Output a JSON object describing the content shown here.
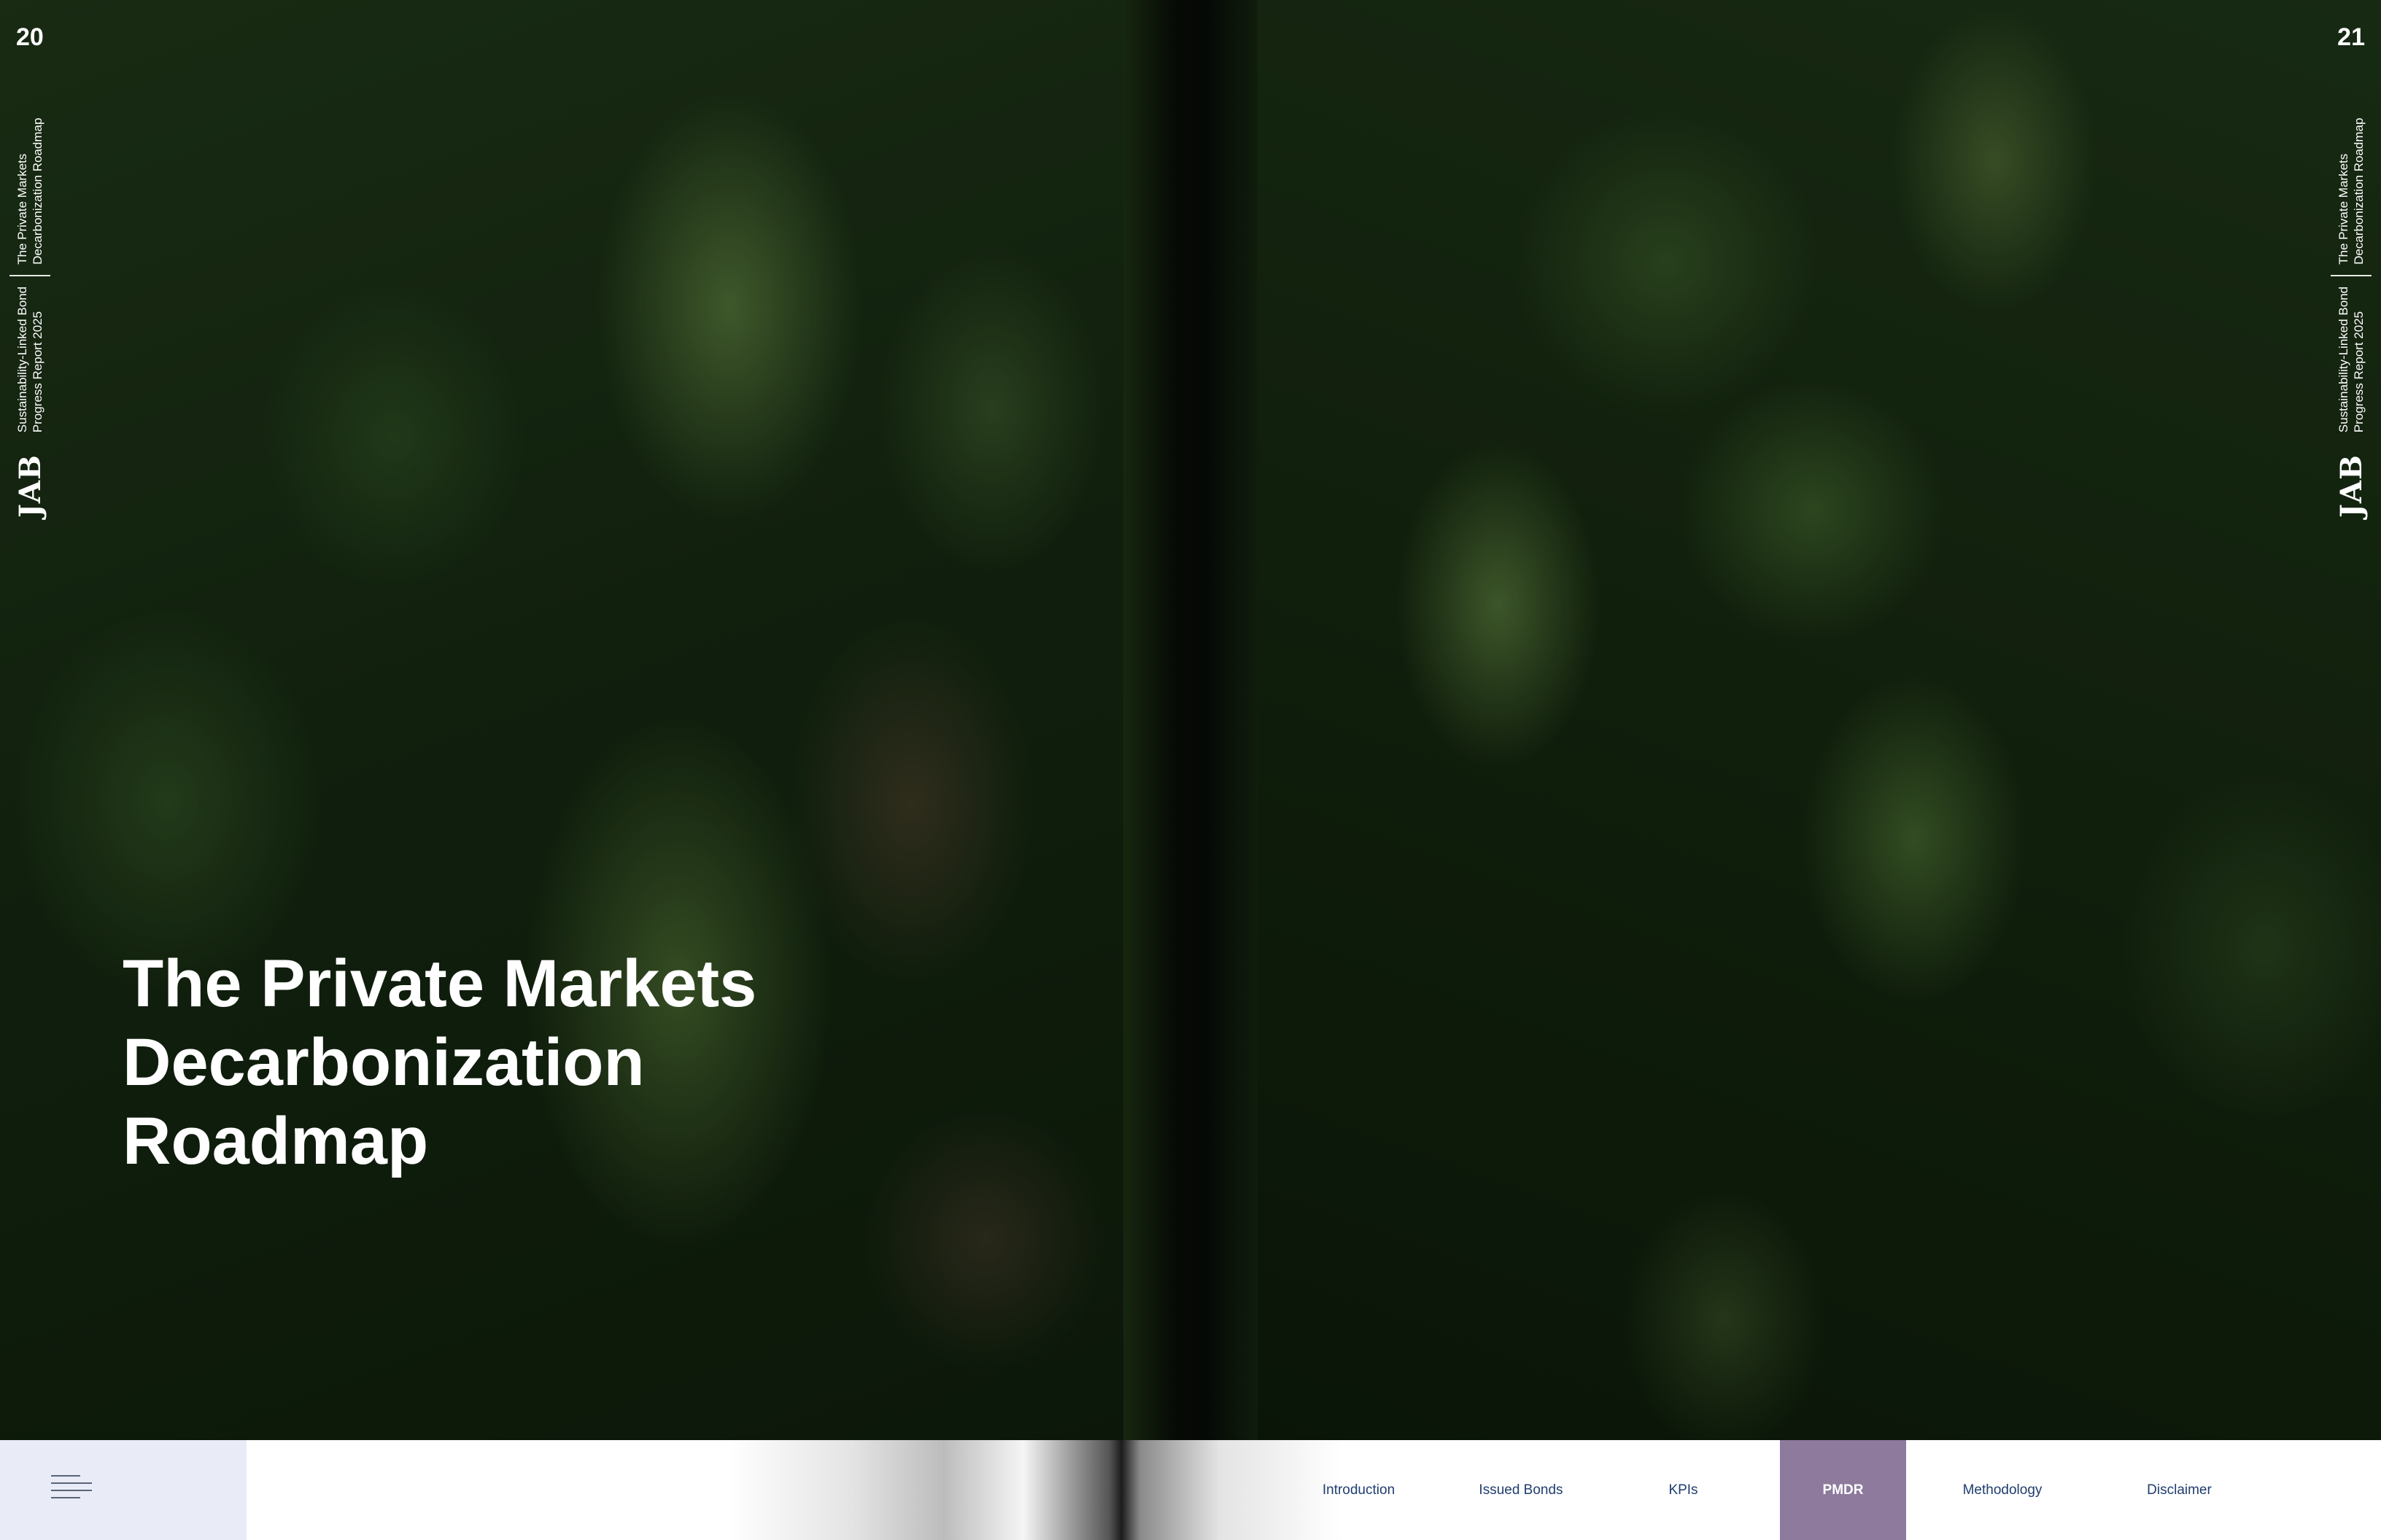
{
  "pages": {
    "left_number": "20",
    "right_number": "21"
  },
  "running_header": {
    "logo": "JAB",
    "report_line1": "Sustainability-Linked Bond",
    "report_line2": "Progress Report 2025",
    "section_line1": "The Private Markets",
    "section_line2": "Decarbonization Roadmap"
  },
  "hero": {
    "title_line1": "The Private Markets",
    "title_line2": "Decarbonization",
    "title_line3": "Roadmap"
  },
  "nav": {
    "items": [
      {
        "label": "Introduction"
      },
      {
        "label": "Issued Bonds"
      },
      {
        "label": "KPIs"
      },
      {
        "label": "PMDR"
      },
      {
        "label": "Methodology"
      },
      {
        "label": "Disclaimer"
      }
    ],
    "active_index": 3,
    "active_color": "#8d7a9c",
    "menu_icon": "hamburger-menu-icon"
  },
  "colors": {
    "nav_text": "#1f3d6e",
    "menu_box": "#e9ecf6",
    "foliage": "#1f3518"
  }
}
